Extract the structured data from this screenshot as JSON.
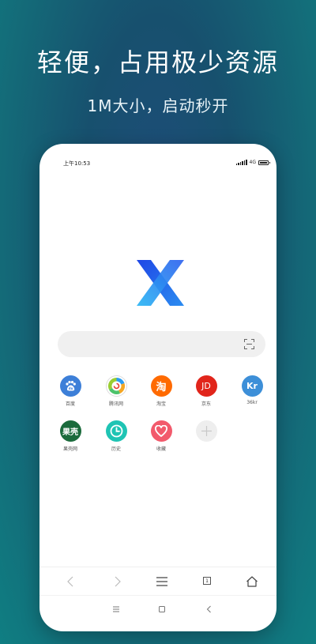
{
  "promo": {
    "headline": "轻便，占用极少资源",
    "subline": "1M大小，启动秒开"
  },
  "status_bar": {
    "time": "上午10:53",
    "network": "4G"
  },
  "shortcuts": [
    {
      "label": "百度",
      "icon_text": "du",
      "icon": "baidu-paw-icon",
      "color": "#3d7fd8"
    },
    {
      "label": "腾讯网",
      "icon_text": "",
      "icon": "tencent-news-icon",
      "color": "#ffffff"
    },
    {
      "label": "淘宝",
      "icon_text": "淘",
      "icon": "taobao-icon",
      "color": "#ff6a00"
    },
    {
      "label": "京东",
      "icon_text": "JD",
      "icon": "jd-icon",
      "color": "#e1251b"
    },
    {
      "label": "36kr",
      "icon_text": "Kr",
      "icon": "36kr-icon",
      "color": "#3d8fd8"
    },
    {
      "label": "果壳网",
      "icon_text": "果壳",
      "icon": "guokr-icon",
      "color": "#1b6b3c"
    },
    {
      "label": "历史",
      "icon_text": "",
      "icon": "clock-icon",
      "color": "#1fc4b4"
    },
    {
      "label": "收藏",
      "icon_text": "",
      "icon": "heart-icon",
      "color": "#f25a6c"
    },
    {
      "label": "",
      "icon_text": "",
      "icon": "add-icon",
      "color": "#eeeeee"
    }
  ],
  "toolbar": {
    "tab_count": "1"
  },
  "colors": {
    "logo_blue": "#1a56e8",
    "logo_light": "#2aa3f2"
  }
}
